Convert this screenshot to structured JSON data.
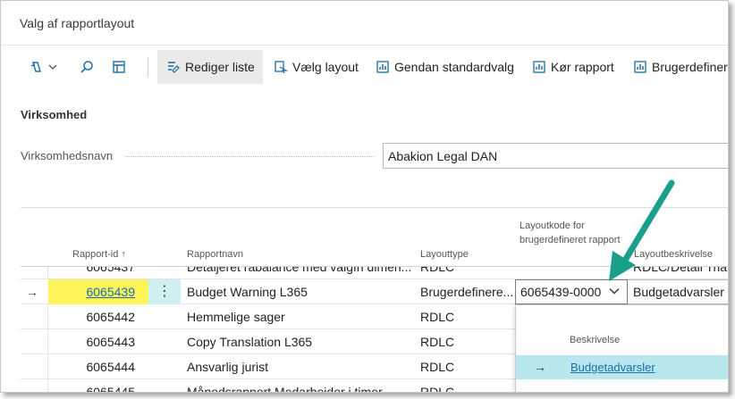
{
  "window": {
    "title": "Valg af rapportlayout"
  },
  "toolbar": {
    "edit_list": "Rediger liste",
    "choose_layout": "Vælg layout",
    "restore_default": "Gendan standardvalg",
    "run_report": "Kør rapport",
    "custom": "Brugerdefinere"
  },
  "section": {
    "title": "Virksomhed"
  },
  "company": {
    "label": "Virksomhedsnavn",
    "value": "Abakion Legal DAN"
  },
  "columns": {
    "report_id": "Rapport-id ↑",
    "report_name": "Rapportnavn",
    "layout_type": "Layouttype",
    "layout_code": "Layoutkode for brugerdefineret rapport",
    "layout_desc": "Layoutbeskrivelse"
  },
  "rows": [
    {
      "id": "6065437",
      "name": "Detaljeret råbalance med valgfri dimen...",
      "type": "RDLC",
      "code": "",
      "desc": "RDLC/Detail Trial"
    },
    {
      "id": "6065439",
      "name": "Budget Warning L365",
      "type": "Brugerdefinere...",
      "code": "6065439-0000",
      "desc": "Budgetadvarsler"
    },
    {
      "id": "6065442",
      "name": "Hemmelige sager",
      "type": "RDLC",
      "code": "",
      "desc": ""
    },
    {
      "id": "6065443",
      "name": "Copy Translation L365",
      "type": "RDLC",
      "code": "",
      "desc": ""
    },
    {
      "id": "6065444",
      "name": "Ansvarlig jurist",
      "type": "RDLC",
      "code": "",
      "desc": ""
    },
    {
      "id": "6065445",
      "name": "Månedsrapport Medarbejder i timer...",
      "type": "RDLC",
      "code": "",
      "desc": ""
    }
  ],
  "lookup": {
    "header": "Beskrivelse",
    "item": "Budgetadvarsler"
  },
  "colors": {
    "highlight": "#fdf45c",
    "selection": "#b8e8ee",
    "arrow": "#1aa08a",
    "link": "#1b6ea8"
  }
}
